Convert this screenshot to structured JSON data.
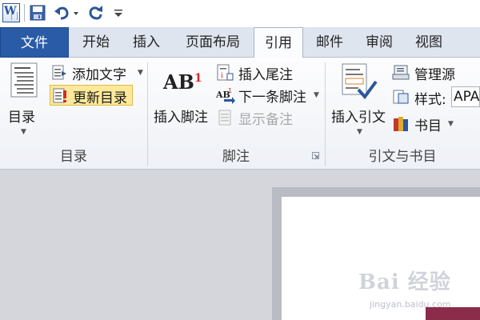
{
  "app": {
    "icon_letter": "W"
  },
  "tabs": [
    "文件",
    "开始",
    "插入",
    "页面布局",
    "引用",
    "邮件",
    "审阅",
    "视图"
  ],
  "active_tab": "引用",
  "groups": {
    "toc": {
      "label": "目录",
      "big_button": "目录",
      "add_text": "添加文字",
      "update_toc": "更新目录"
    },
    "footnotes": {
      "label": "脚注",
      "insert_footnote": "插入脚注",
      "insert_endnote": "插入尾注",
      "next_footnote": "下一条脚注",
      "show_notes": "显示备注",
      "ab_glyph": "AB",
      "ab_sup": "1"
    },
    "citations": {
      "label": "引文与书目",
      "insert_citation": "插入引文",
      "manage_sources": "管理源",
      "style_label": "样式:",
      "style_value": "APA",
      "bibliography": "书目"
    }
  },
  "watermark": {
    "big": "Bai 经验",
    "small": "jingyan.baidu.com"
  },
  "colors": {
    "file_tab": "#2a5ba6",
    "highlight": "#fde99a",
    "accent_blue": "#2b579a"
  }
}
